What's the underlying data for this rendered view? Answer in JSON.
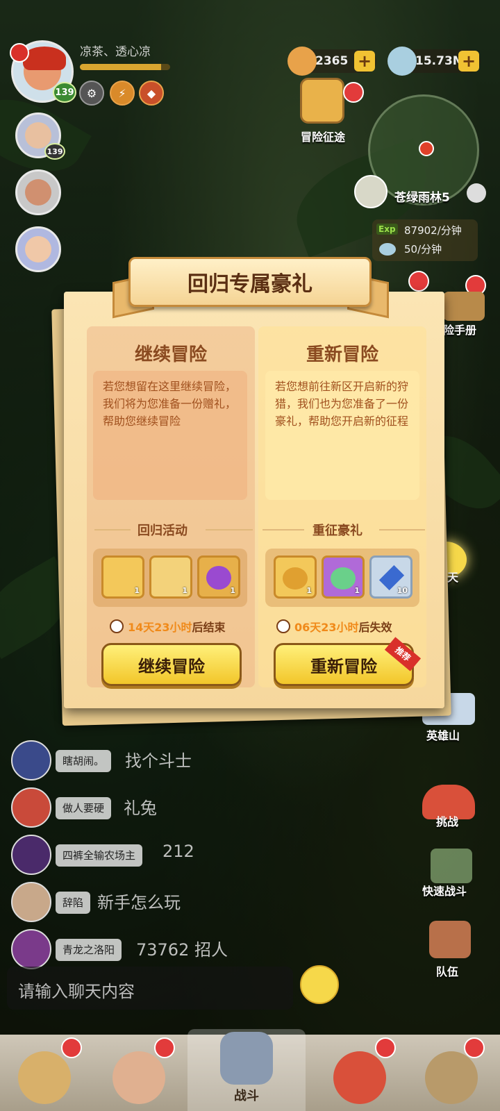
{
  "player": {
    "name": "凉茶、透心凉",
    "level": "139",
    "exp_fraction": 0.9
  },
  "team_levels": [
    "139"
  ],
  "currency": {
    "coins": "2365",
    "gems": "15.73M"
  },
  "adventure_route": {
    "label": "冒险征途"
  },
  "map": {
    "location": "苍绿雨林5",
    "exp_rate": "87902/分钟",
    "exp_label": "Exp",
    "resource_rate": "50/分钟"
  },
  "side_buttons": {
    "handbook": "险手册",
    "chat": "聊天",
    "hero_mountain": "英雄山",
    "challenge": "挑战",
    "quick_battle": "快速战斗",
    "team": "队伍"
  },
  "dialog": {
    "title": "回归专属豪礼",
    "left": {
      "title": "继续冒险",
      "description": "若您想留在这里继续冒险，我们将为您准备一份赠礼，帮助您继续冒险",
      "reward_title": "回归活动",
      "items": [
        {
          "icon": "ticket-icon",
          "count": "1"
        },
        {
          "icon": "card-icon",
          "count": "1"
        },
        {
          "icon": "purple-bag-icon",
          "count": "1"
        }
      ],
      "timer_highlight": "14天23小时",
      "timer_suffix": "后结束",
      "button": "继续冒险"
    },
    "right": {
      "title": "重新冒险",
      "description": "若您想前往新区开启新的狩猎，我们也为您准备了一份豪礼，帮助您开启新的征程",
      "reward_title": "重征豪礼",
      "items": [
        {
          "icon": "gold-bag-icon",
          "count": "1"
        },
        {
          "icon": "green-bag-icon",
          "count": "1"
        },
        {
          "icon": "blue-crystal-icon",
          "count": "10"
        }
      ],
      "timer_highlight": "06天23小时",
      "timer_suffix": "后失效",
      "button": "重新冒险",
      "tag": "推荐"
    }
  },
  "chat": {
    "messages": [
      {
        "name": "瞎胡闹。",
        "text": "找个斗士"
      },
      {
        "name": "做人要硬",
        "text": "礼兔"
      },
      {
        "name": "四裤全输农场主",
        "text": "212"
      },
      {
        "name": "辞陷",
        "text": "新手怎么玩"
      },
      {
        "name": "青龙之洛阳",
        "text": "73762 招人"
      }
    ],
    "input_placeholder": "请输入聊天内容"
  },
  "bottom_nav": {
    "active_label": "战斗"
  },
  "colors": {
    "accent_yellow": "#f2c62a",
    "dialog_bg": "#f6d79d",
    "title_brown": "#5a2e12",
    "timer_orange": "#f08a1a"
  }
}
